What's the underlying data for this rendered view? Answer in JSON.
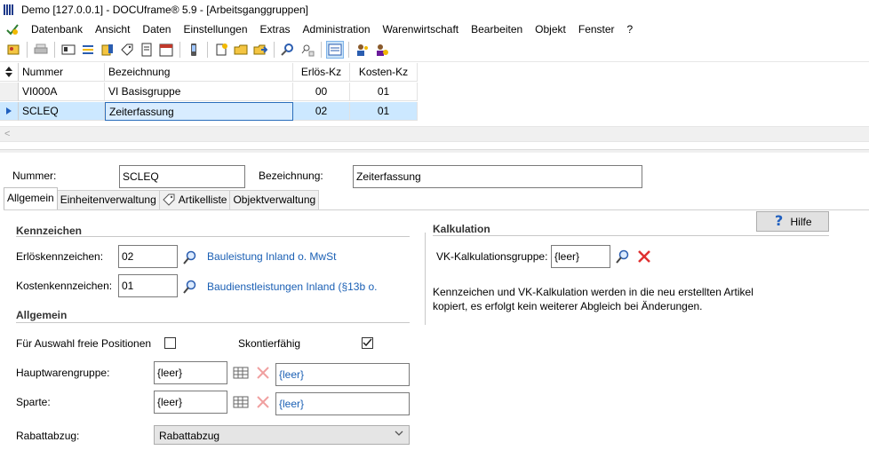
{
  "window": {
    "title": "Demo [127.0.0.1] - DOCUframe® 5.9 - [Arbeitsganggruppen]"
  },
  "menu": [
    "Datenbank",
    "Ansicht",
    "Daten",
    "Einstellungen",
    "Extras",
    "Administration",
    "Warenwirtschaft",
    "Bearbeiten",
    "Objekt",
    "Fenster",
    "?"
  ],
  "grid": {
    "columns": [
      "Nummer",
      "Bezeichnung",
      "Erlös-Kz",
      "Kosten-Kz"
    ],
    "rows": [
      {
        "nummer": "VI000A",
        "bezeichnung": "VI Basisgruppe",
        "erloes": "00",
        "kosten": "01"
      },
      {
        "nummer": "SCLEQ",
        "bezeichnung": "Zeiterfassung",
        "erloes": "02",
        "kosten": "01"
      }
    ],
    "scroll_left": "<"
  },
  "header": {
    "nummer_label": "Nummer:",
    "nummer_value": "SCLEQ",
    "bezeichnung_label": "Bezeichnung:",
    "bezeichnung_value": "Zeiterfassung"
  },
  "tabs": [
    "Allgemein",
    "Einheitenverwaltung",
    "Artikelliste",
    "Objektverwaltung"
  ],
  "help_label": "Hilfe",
  "kennzeichen": {
    "heading": "Kennzeichen",
    "erloes_label": "Erlöskennzeichen:",
    "erloes_value": "02",
    "erloes_link": "Bauleistung Inland o. MwSt",
    "kosten_label": "Kostenkennzeichen:",
    "kosten_value": "01",
    "kosten_link": "Baudienstleistungen Inland (§13b o."
  },
  "allgemein": {
    "heading": "Allgemein",
    "freie_label": "Für Auswahl freie Positionen",
    "freie_checked": false,
    "skonto_label": "Skontierfähig",
    "skonto_checked": true,
    "hwg_label": "Hauptwarengruppe:",
    "hwg_value": "{leer}",
    "hwg_link": "{leer}",
    "sparte_label": "Sparte:",
    "sparte_value": "{leer}",
    "sparte_link": "{leer}",
    "rabatt_label": "Rabattabzug:",
    "rabatt_value": "Rabattabzug"
  },
  "kalkulation": {
    "heading": "Kalkulation",
    "gruppe_label": "VK-Kalkulationsgruppe:",
    "gruppe_value": "{leer}",
    "note": "Kennzeichen und VK-Kalkulation werden in die neu erstellten Artikel kopiert, es erfolgt kein weiterer Abgleich bei Änderungen."
  },
  "colors": {
    "link": "#1a5fb4",
    "selection": "#cce8ff",
    "delete": "#e03030"
  }
}
